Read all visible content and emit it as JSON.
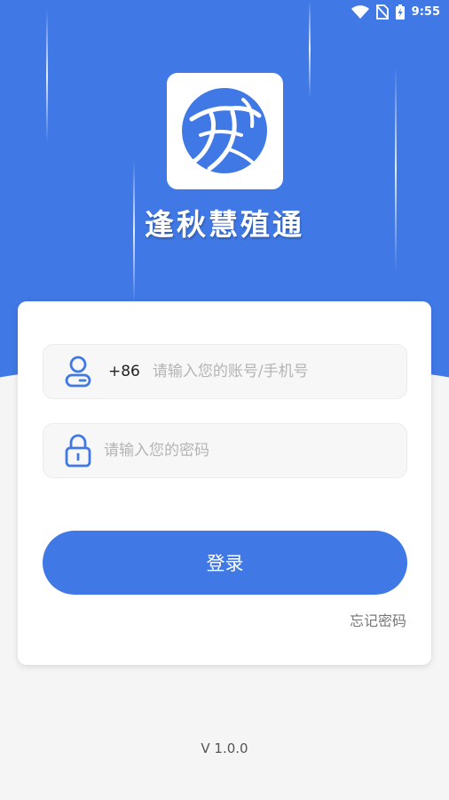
{
  "status_bar": {
    "time": "9:55",
    "icons": [
      "wifi-icon",
      "no-sim-icon",
      "battery-charging-icon"
    ]
  },
  "app": {
    "title": "逢秋慧殖通",
    "logo": "app-logo-icon"
  },
  "login_form": {
    "country_code": "+86",
    "account_placeholder": "请输入您的账号/手机号",
    "account_value": "",
    "password_placeholder": "请输入您的密码",
    "password_value": "",
    "login_label": "登录",
    "forgot_label": "忘记密码"
  },
  "footer": {
    "version": "V 1.0.0"
  },
  "colors": {
    "primary": "#4079e6",
    "background": "#f5f5f5",
    "card": "#ffffff"
  }
}
